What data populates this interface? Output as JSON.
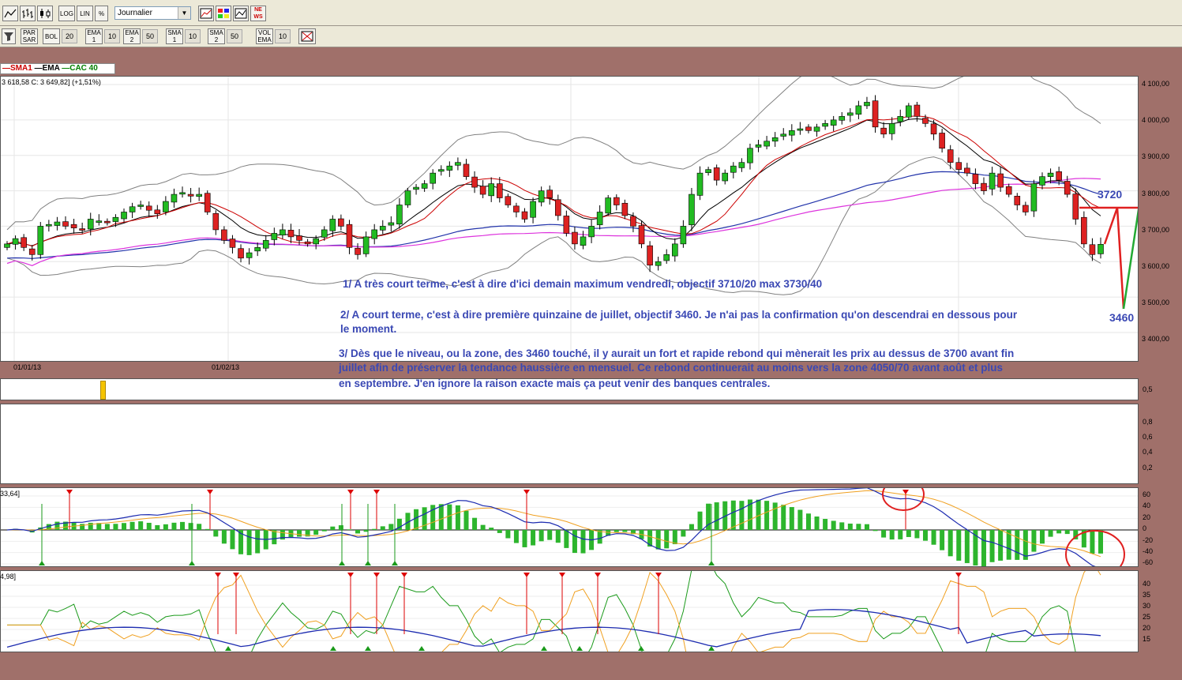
{
  "toolbar_top": {
    "buttons": [
      {
        "name": "line-chart-icon",
        "label": ""
      },
      {
        "name": "bar-chart-icon",
        "label": ""
      },
      {
        "name": "candlestick-icon",
        "label": ""
      },
      {
        "name": "log-button",
        "label": "LOG"
      },
      {
        "name": "lin-button",
        "label": "LIN"
      },
      {
        "name": "percent-button",
        "label": "%"
      }
    ],
    "period_select": "Journalier",
    "icons": [
      "chart-window-icon",
      "palette-icon",
      "compare-chart-icon",
      "news-icon"
    ],
    "news_label": "NE\nWS"
  },
  "toolbar_indicators": [
    {
      "label": "PAR\nSAR",
      "value": ""
    },
    {
      "label": "BOL",
      "value": "20"
    },
    {
      "label": "EMA\n1",
      "value": "10"
    },
    {
      "label": "EMA\n2",
      "value": "50"
    },
    {
      "label": "SMA\n1",
      "value": "10"
    },
    {
      "label": "SMA\n2",
      "value": "50"
    },
    {
      "label": "VOL\nEMA",
      "value": "10"
    }
  ],
  "legend": {
    "sma1": "SMA1",
    "ema": "EMA",
    "cac": "CAC 40",
    "colors": {
      "sma1": "#cc0000",
      "ema": "#000000",
      "cac": "#008000"
    }
  },
  "ohlc_text": "3 618,58   C: 3 649,82] (+1,51%)",
  "price_axis": [
    "4 100,00",
    "4 000,00",
    "3 900,00",
    "3 800,00",
    "3 700,00",
    "3 600,00",
    "3 500,00",
    "3 400,00"
  ],
  "dates": [
    "01/01/13",
    "01/02/13"
  ],
  "annotations": {
    "a1": "1/ A très court terme, c'est à dire d'ici demain maximum vendredi, objectif 3710/20 max 3730/40",
    "a2_l1": "2/ A court terme, c'est à dire première quinzaine de juillet, objectif 3460. Je n'ai pas la confirmation qu'on descendrai en dessous pour",
    "a2_l2": "le moment.",
    "a3_l1": "3/ Dès que le niveau, ou la zone, des 3460 touché, il y aurait un fort et rapide rebond qui mènerait les prix au dessus de 3700 avant fin",
    "a3_l2": "juillet afin de préserver la tendance haussière en mensuel. Ce rebond continuerait au moins vers la zone 4050/70 avant août et plus",
    "a3_l3": "en septembre. J'en ignore la raison exacte mais ça peut venir des banques centrales."
  },
  "targets": {
    "t1": "3720",
    "t2": "3460"
  },
  "panel2_axis": [
    "0,5"
  ],
  "panel3_axis": [
    "0,8",
    "0,6",
    "0,4",
    "0,2"
  ],
  "macd_label": "33,64]",
  "macd_axis": [
    "60",
    "40",
    "20",
    "0",
    "-20",
    "-40",
    "-60"
  ],
  "stoch_label": "4,98]",
  "stoch_axis": [
    "40",
    "35",
    "30",
    "25",
    "20",
    "15"
  ],
  "colors": {
    "up": "#22bb22",
    "down": "#dd2222",
    "annotation": "#3a48b4",
    "bollinger": "#808080",
    "ema50": "#2233aa",
    "sma50": "#dd33dd"
  }
}
